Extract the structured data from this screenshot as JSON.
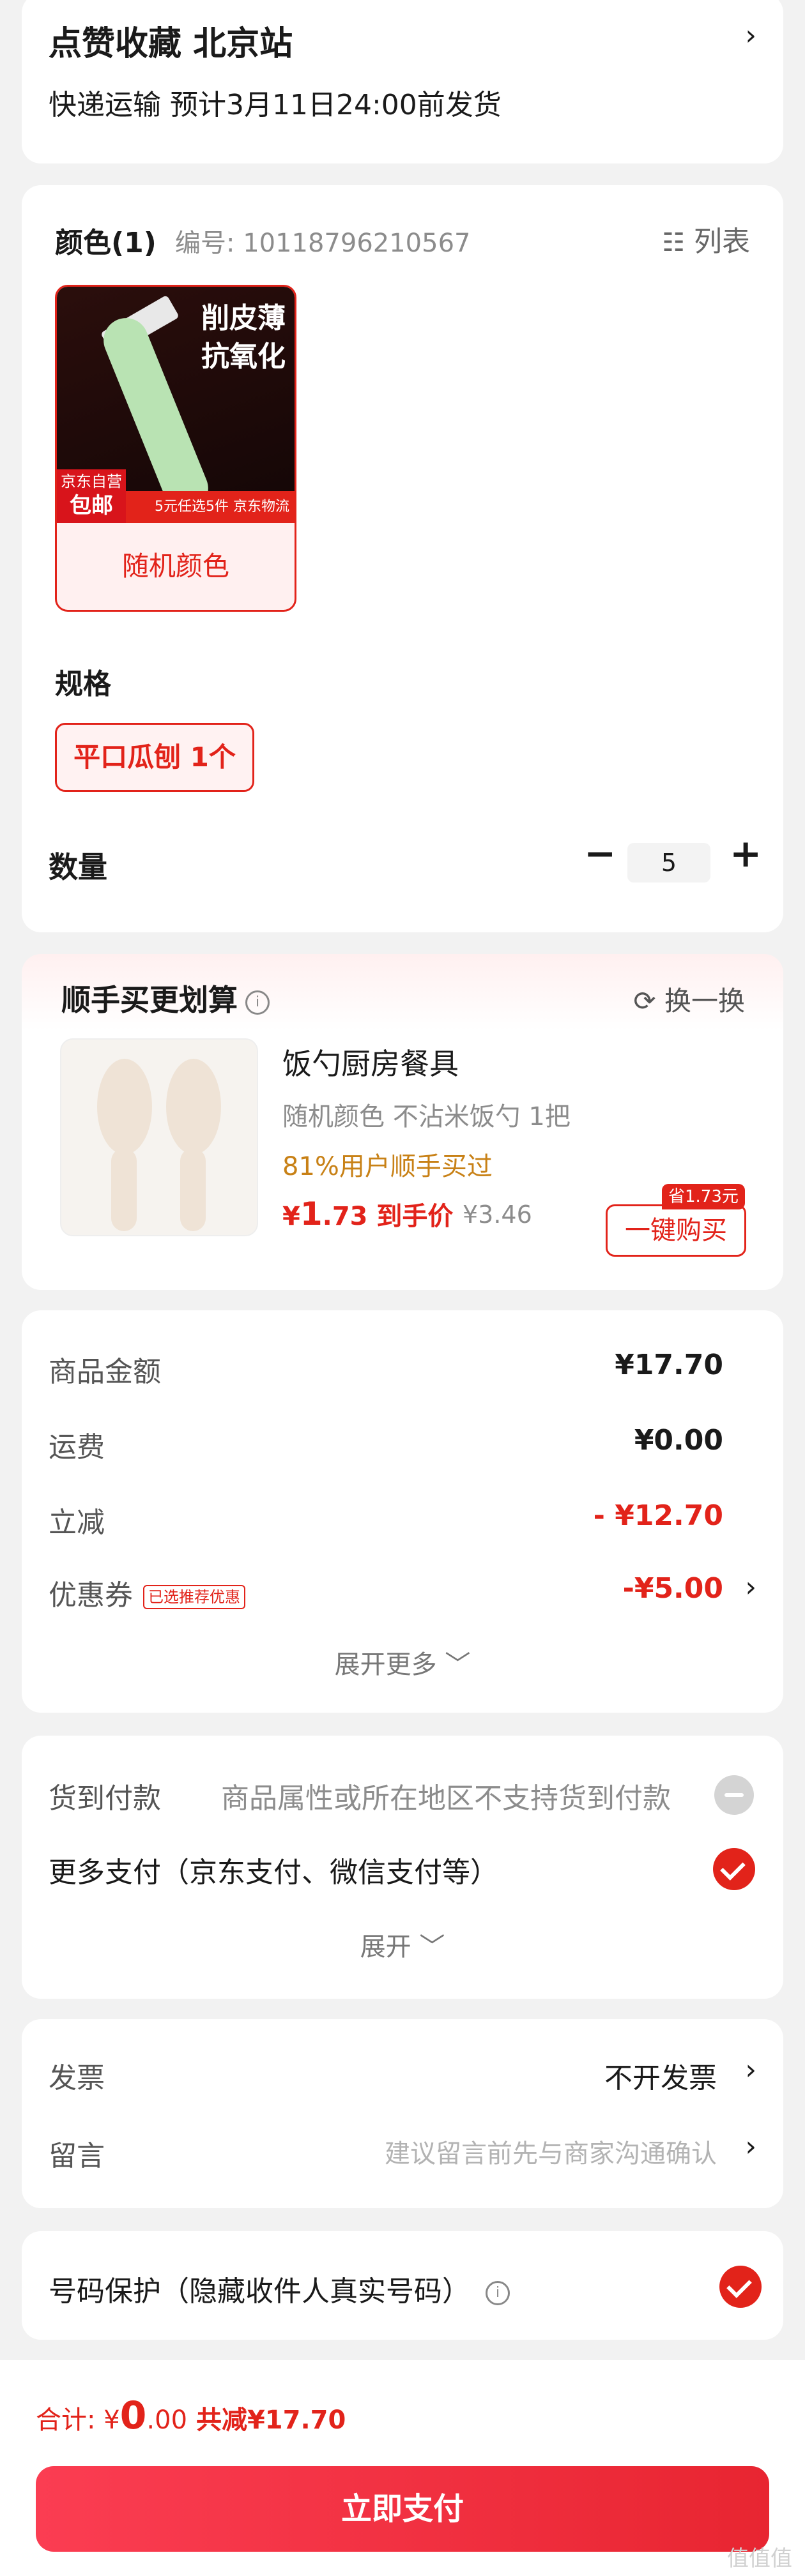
{
  "shipping": {
    "title": "点赞收藏  北京站",
    "subtitle": "快递运输 预计3月11日24:00前发货"
  },
  "sku": {
    "color_heading": "颜色(1)",
    "code": "编号: 10118796210567",
    "list_label": "列表",
    "product": {
      "image_text_1": "削皮薄",
      "image_text_2": "抗氧化",
      "badge_small": "京东自营",
      "badge_big": "包邮",
      "strip_text": "5元任选5件 京东物流",
      "label": "随机颜色"
    },
    "spec_heading": "规格",
    "spec_option": "平口瓜刨 1个",
    "qty_heading": "数量",
    "qty_minus": "−",
    "qty_value": "5",
    "qty_plus": "+"
  },
  "addon": {
    "title": "顺手买更划算",
    "info": "i",
    "swap_label": "换一换",
    "name": "饭勺厨房餐具",
    "attrs": "随机颜色   不沾米饭勺 1把",
    "popularity": "81%用户顺手买过",
    "price_symbol": "¥",
    "price_int": "1",
    "price_dec": ".73",
    "price_suffix": " 到手价",
    "orig_price": "¥3.46",
    "save_tag": "省1.73元",
    "buy_label": "一键购买"
  },
  "amounts": {
    "rows": [
      {
        "label": "商品金额",
        "value": "¥17.70"
      },
      {
        "label": "运费",
        "value": "¥0.00"
      },
      {
        "label": "立减",
        "value": "- ¥12.70"
      },
      {
        "label": "优惠券",
        "tag": "已选推荐优惠",
        "value": "-¥5.00"
      }
    ],
    "expand_label": "展开更多 ﹀"
  },
  "payment": {
    "cod_label": "货到付款",
    "cod_note": "商品属性或所在地区不支持货到付款",
    "more_label": "更多支付（京东支付、微信支付等）",
    "expand_label": "展开 ﹀"
  },
  "invoice": {
    "label": "发票",
    "value": "不开发票",
    "note_label": "留言",
    "note_placeholder": "建议留言前先与商家沟通确认"
  },
  "privacy": {
    "label": "号码保护（隐藏收件人真实号码）"
  },
  "bottom": {
    "total_label": "合计: ",
    "total_symbol": "¥",
    "total_int": "0",
    "total_dec": ".00",
    "saved": " 共减¥17.70",
    "pay_label": "立即支付",
    "watermark": "值值值"
  },
  "colors": {
    "accent": "#e2231a",
    "gold": "#c88116"
  }
}
